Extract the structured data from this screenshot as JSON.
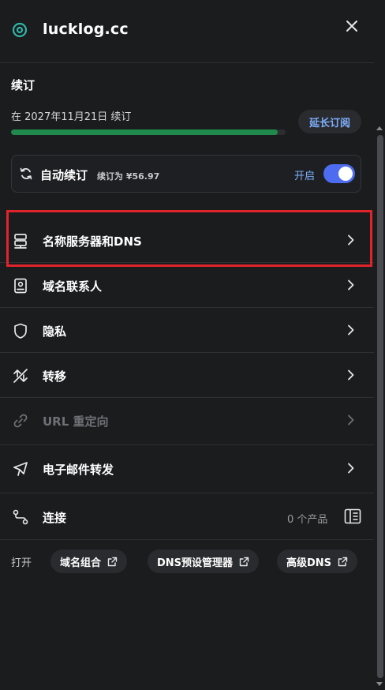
{
  "header": {
    "title": "lucklog.cc",
    "logo_icon": "target-ring-icon",
    "close_icon": "close-icon"
  },
  "renewal": {
    "section_title": "续订",
    "renew_date_text": "在 2027年11月21日 续订",
    "progress_fraction": 0.97,
    "progress_color": "#1f8a4c",
    "extend_button": "延长订阅",
    "auto_renew": {
      "label": "自动续订",
      "price_text": "续订为 ¥56.97",
      "state_text": "开启",
      "enabled": true,
      "toggle_color": "#4d6cf0"
    }
  },
  "menu": {
    "items": [
      {
        "label": "名称服务器和DNS",
        "icon": "server-icon",
        "enabled": true,
        "highlighted": true
      },
      {
        "label": "域名联系人",
        "icon": "contact-book-icon",
        "enabled": true
      },
      {
        "label": "隐私",
        "icon": "shield-icon",
        "enabled": true
      },
      {
        "label": "转移",
        "icon": "transfer-arrows-icon",
        "enabled": true
      },
      {
        "label": "URL 重定向",
        "icon": "link-icon",
        "enabled": false
      },
      {
        "label": "电子邮件转发",
        "icon": "email-forward-icon",
        "enabled": true
      },
      {
        "label": "连接",
        "icon": "connect-icon",
        "enabled": true,
        "count_text": "0 个产品",
        "action_icon": "side-panel-icon"
      }
    ]
  },
  "open_links": {
    "label": "打开",
    "chips": [
      {
        "label": "域名组合",
        "icon": "external-link-icon"
      },
      {
        "label": "DNS预设管理器",
        "icon": "external-link-icon"
      },
      {
        "label": "高级DNS",
        "icon": "external-link-icon"
      }
    ]
  },
  "colors": {
    "background": "#1b1c1e",
    "accent_link": "#7fb0ff",
    "highlight_border": "#e0242b"
  }
}
